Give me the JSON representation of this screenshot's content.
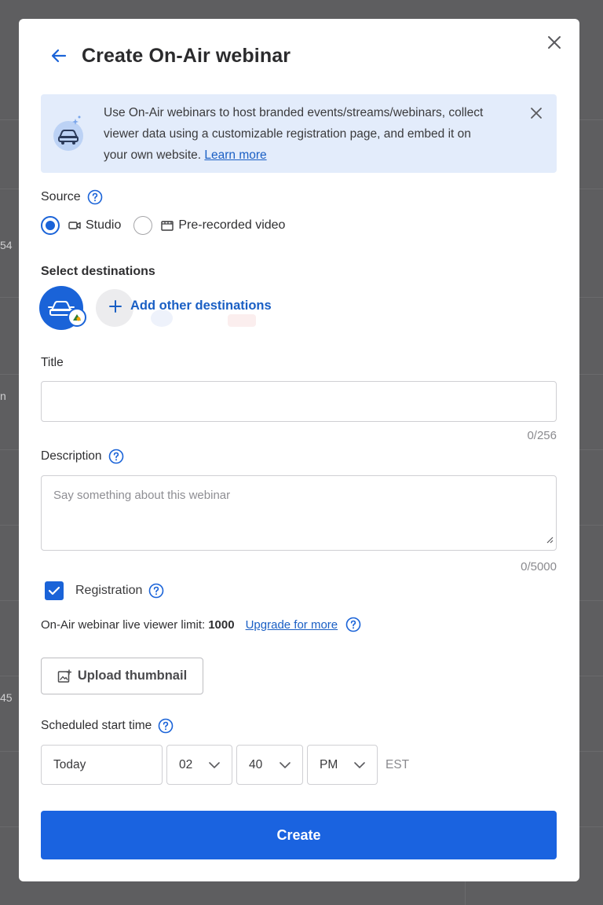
{
  "background": {
    "side_texts": [
      "54",
      "n",
      "45"
    ]
  },
  "dialog": {
    "title": "Create On-Air webinar",
    "banner": {
      "text": "Use On-Air webinars to host branded events/streams/webinars, collect viewer data using a customizable registration page, and embed it on your own website.",
      "link": "Learn more"
    },
    "source": {
      "label": "Source",
      "options": [
        {
          "label": "Studio",
          "icon": "camera-icon",
          "selected": true
        },
        {
          "label": "Pre-recorded video",
          "icon": "film-icon",
          "selected": false
        }
      ]
    },
    "destinations": {
      "label": "Select destinations",
      "add_label": "Add other destinations"
    },
    "title_field": {
      "label": "Title",
      "value": "",
      "counter": "0/256"
    },
    "description_field": {
      "label": "Description",
      "placeholder": "Say something about this webinar",
      "counter": "0/5000"
    },
    "registration": {
      "label": "Registration",
      "checked": true
    },
    "limit": {
      "prefix": "On-Air webinar live viewer limit:",
      "value": "1000",
      "upgrade": "Upgrade for more"
    },
    "upload": {
      "label": "Upload thumbnail"
    },
    "schedule": {
      "label": "Scheduled start time",
      "date": "Today",
      "hour": "02",
      "minute": "40",
      "ampm": "PM",
      "timezone": "EST"
    },
    "create_label": "Create"
  },
  "colors": {
    "accent": "#1a63e0",
    "banner_bg": "#e3ecfb",
    "link": "#1a5fc4",
    "overlay": "#5e5e60"
  }
}
